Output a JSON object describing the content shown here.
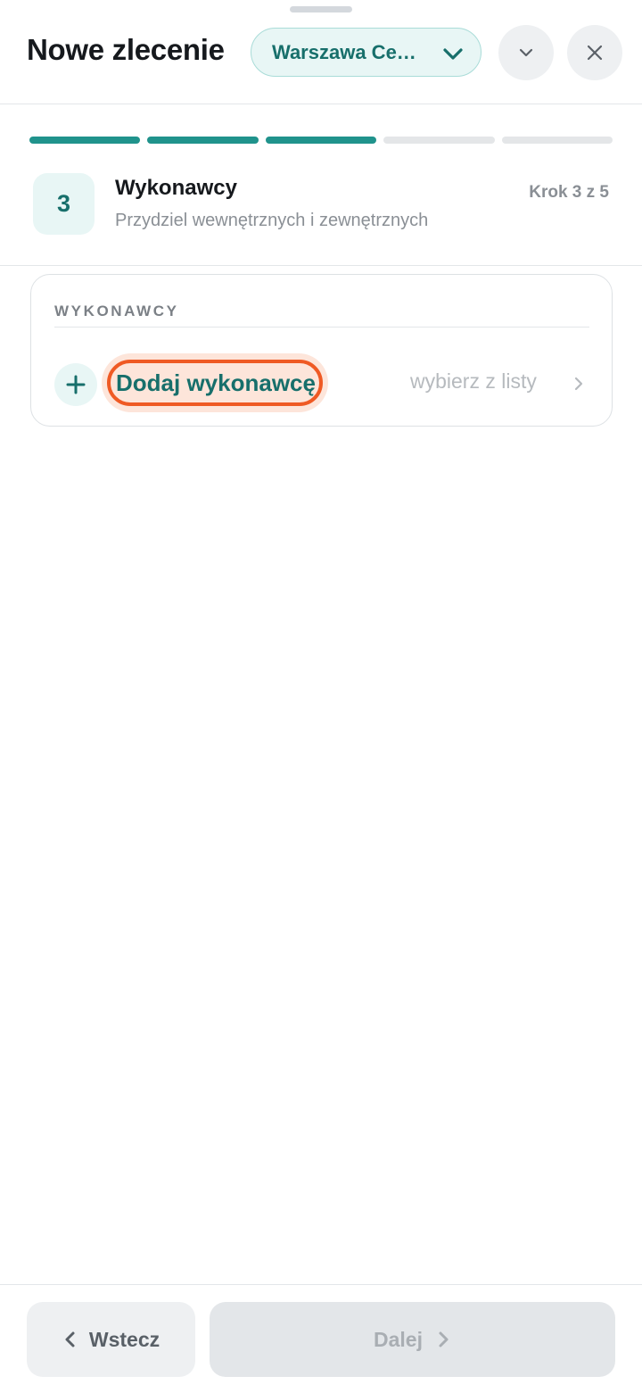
{
  "header": {
    "title": "Nowe zlecenie",
    "branch_label": "Warszawa Ce…",
    "branch_icon": "chevron-down-icon",
    "collapse_icon": "chevron-down-icon",
    "close_icon": "close-icon"
  },
  "progress": {
    "total_steps": 5,
    "completed_steps": 3,
    "color_done": "#20938c",
    "color_todo": "#e4e6e8"
  },
  "step": {
    "number": "3",
    "title": "Wykonawcy",
    "subtitle": "Przydziel wewnętrznych i zewnętrznych",
    "counter": "Krok 3 z 5"
  },
  "card": {
    "heading": "WYKONAWCY",
    "add_label": "Dodaj wykonawcę",
    "hint": "wybierz z listy",
    "add_icon": "plus-icon",
    "hint_icon": "chevron-right-icon",
    "highlight_color": "#ef5a24"
  },
  "footer": {
    "back_label": "Wstecz",
    "next_label": "Dalej"
  },
  "colors": {
    "accent": "#176f6b",
    "accent_bg": "#e8f6f5"
  }
}
